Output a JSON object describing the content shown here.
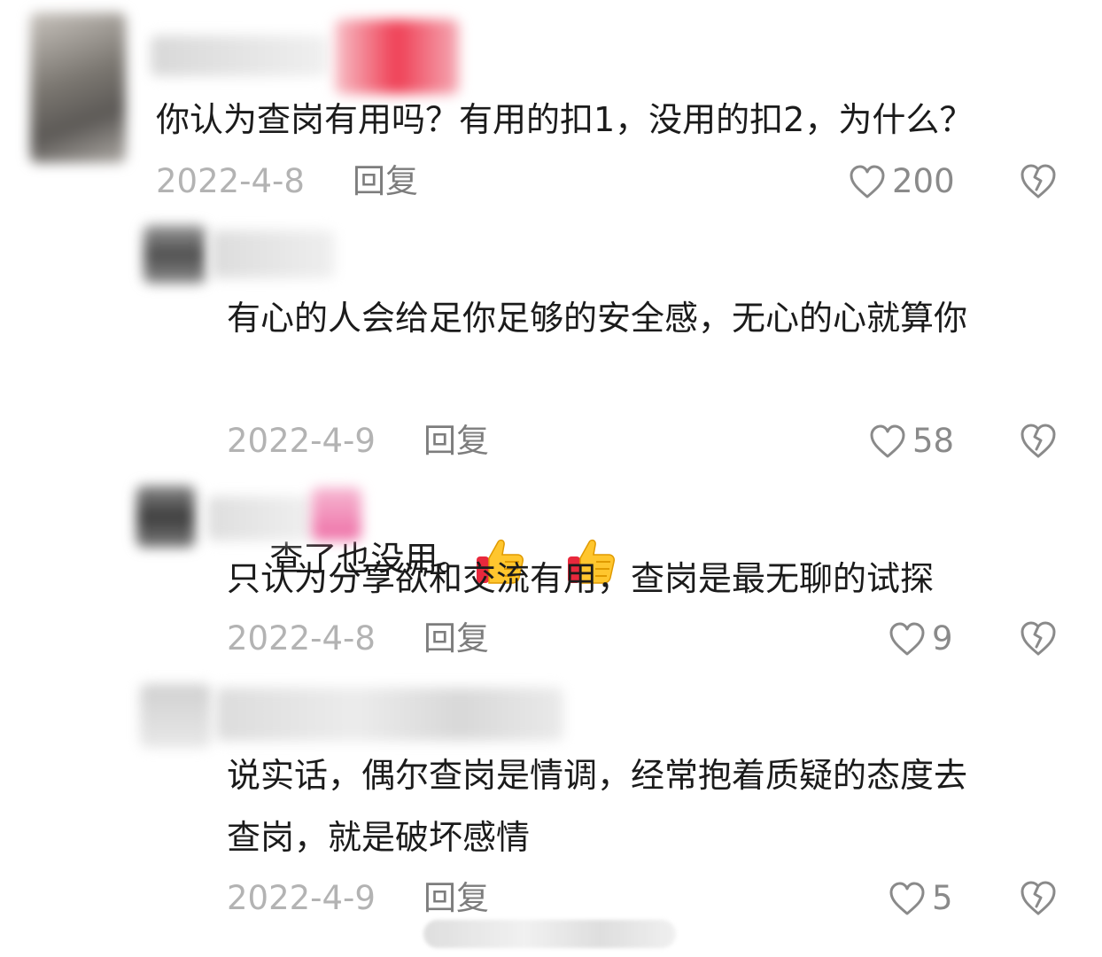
{
  "comments": [
    {
      "text": "你认为查岗有用吗？有用的扣1，没用的扣2，为什么？",
      "date": "2022-4-8",
      "reply": "回复",
      "likes": "200"
    },
    {
      "text_line1": "有心的人会给足你足够的安全感，无心的心就算你",
      "text_line2": "查了也没用。",
      "emoji": "thumbs-up-icon",
      "date": "2022-4-9",
      "reply": "回复",
      "likes": "58"
    },
    {
      "text": "只认为分享欲和交流有用，查岗是最无聊的试探",
      "date": "2022-4-8",
      "reply": "回复",
      "likes": "9"
    },
    {
      "text_line1": "说实话，偶尔查岗是情调，经常抱着质疑的态度去",
      "text_line2": "查岗，就是破坏感情",
      "date": "2022-4-9",
      "reply": "回复",
      "likes": "5"
    }
  ],
  "colors": {
    "text": "#1b1b1b",
    "date": "#b3b3b3",
    "reply": "#7d7d7d",
    "icon": "#8a8a8a"
  }
}
